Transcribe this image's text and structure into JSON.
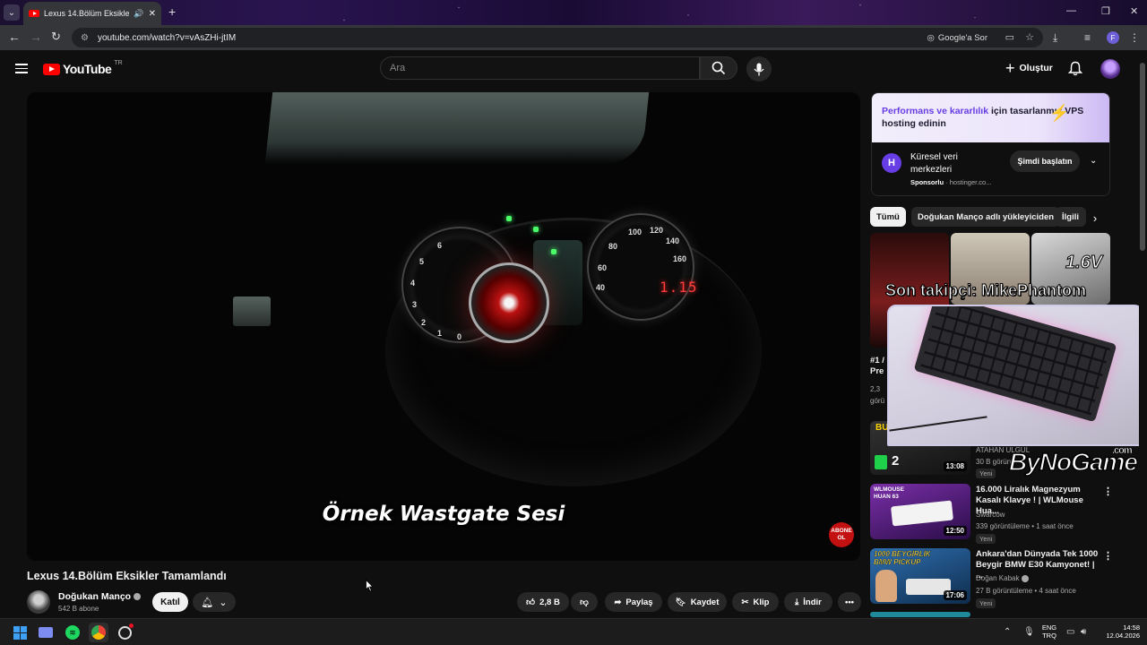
{
  "browser": {
    "tab_title": "Lexus 14.Bölüm Eksikler Ta",
    "url": "youtube.com/watch?v=vAsZHi-jtIM",
    "google_ask": "Google'a Sor",
    "profile_initial": "F"
  },
  "header": {
    "logo_text": "YouTube",
    "country_code": "TR",
    "search_placeholder": "Ara",
    "create_label": "Oluştur"
  },
  "player": {
    "subtitle": "Örnek Wastgate Sesi",
    "red_display": "1.15",
    "badge_text": "ABONE OL",
    "gauge_ticks": [
      "6",
      "5",
      "4",
      "3",
      "2",
      "1",
      "0",
      "80",
      "100",
      "120",
      "140",
      "160",
      "40",
      "60"
    ]
  },
  "video": {
    "title": "Lexus 14.Bölüm Eksikler Tamamlandı",
    "channel": "Doğukan Manço",
    "subscribers": "542 B abone",
    "join_label": "Katıl",
    "like_count": "2,8 B",
    "share_label": "Paylaş",
    "save_label": "Kaydet",
    "clip_label": "Klip",
    "download_label": "İndir"
  },
  "ad": {
    "banner_accent": "Performans ve kararlılık",
    "banner_rest": " için tasarlanmış VPS hosting edinin",
    "name": "Küresel veri merkezleri",
    "sponsored": "Sponsorlu",
    "domain": "hostinger.co...",
    "cta": "Şimdi başlatın"
  },
  "chips": [
    "Tümü",
    "Doğukan Manço adlı yükleyiciden",
    "İlgili"
  ],
  "recommendations": {
    "partial_1": {
      "title_prefix": "#1 /",
      "title_line2": "Pre",
      "meta_1": "2,3",
      "meta_2": "görü"
    },
    "partial_2": {
      "channel": "ATAHAN ULGUL",
      "meta": "30 B görünt",
      "badge": "Yeni",
      "duration": "13:08",
      "thumb_text": "BU"
    },
    "items": [
      {
        "title": "16.000 Liralık Magnezyum Kasalı Klavye ! | WLMouse Hua...",
        "channel": "Swarcow",
        "meta": "339 görüntüleme • 1 saat önce",
        "badge": "Yeni",
        "duration": "12:50",
        "thumb_text": "WLMOUSE HUAN 63"
      },
      {
        "title": "Ankara'dan Dünyada Tek 1000 Beygir BMW E30 Kamyonet! | ...",
        "channel": "Doğan Kabak",
        "meta": "27 B görüntüleme • 4 saat önce",
        "badge": "Yeni",
        "duration": "17:06",
        "thumb_text": "1000 BEYGİRLİK BMW PICKUP"
      }
    ],
    "top_thumb_text": "1.6V"
  },
  "overlay": {
    "follower_text": "Son takipçi: MikePhantom",
    "brand": "ByNoGame",
    "brand_suffix": ".com"
  },
  "taskbar": {
    "lang_line1": "ENG",
    "lang_line2": "TRQ",
    "time": "14:58",
    "date": "12.04.2026"
  }
}
